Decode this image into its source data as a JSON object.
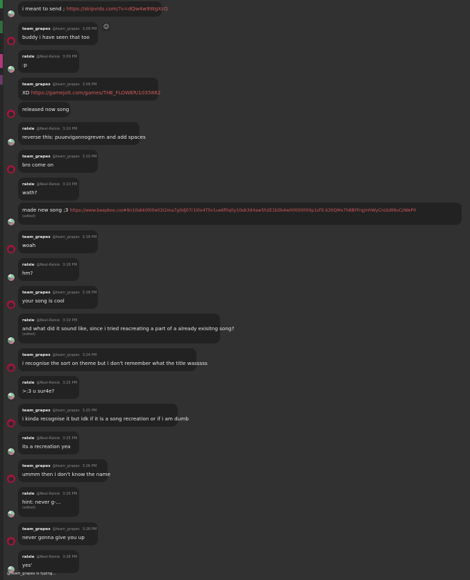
{
  "colors": {
    "background": "#313131",
    "bubble": "#222222",
    "link": "#d65a5a",
    "muted": "#8a8a8a"
  },
  "react_icon": "add-reaction-icon",
  "messages": [
    {
      "id": "m1",
      "author": "ralsie",
      "name": "",
      "handle": "",
      "time": "",
      "text": "i meant to send ; ",
      "link": "https://skipvids.com/?v=dQw4w9WgXcQ",
      "edited": ""
    },
    {
      "id": "m2",
      "author": "grapes",
      "name": "team_grapes",
      "handle": "@team_grapes",
      "time": "3:09 PM",
      "text": "buddy i have seen that too",
      "link": "",
      "edited": ""
    },
    {
      "id": "m3",
      "author": "ralsie",
      "name": "ralsie",
      "handle": "@Real-Ralsie",
      "time": "3:09 PM",
      "text": ":p",
      "link": "",
      "edited": ""
    },
    {
      "id": "m4",
      "author": "grapes",
      "name": "team_grapes",
      "handle": "@team_grapes",
      "time": "3:09 PM",
      "text": "XD ",
      "link": "https://gamejolt.com/games/THE_FLOWER/1035882",
      "edited": ""
    },
    {
      "id": "m5",
      "author": "grapes",
      "name": "",
      "handle": "",
      "time": "",
      "text": "released now song",
      "link": "",
      "edited": ""
    },
    {
      "id": "m6",
      "author": "ralsie",
      "name": "ralsie",
      "handle": "@Real-Ralsie",
      "time": "3:10 PM",
      "text": "reverse this: puuevigannogreven and add spaces",
      "link": "",
      "edited": ""
    },
    {
      "id": "m7",
      "author": "grapes",
      "name": "team_grapes",
      "handle": "@team_grapes",
      "time": "3:10 PM",
      "text": "bro come on",
      "link": "",
      "edited": ""
    },
    {
      "id": "m8",
      "author": "ralsie",
      "name": "ralsie",
      "handle": "@Real-Ralsie",
      "time": "3:10 PM",
      "text": "wath?",
      "link": "",
      "edited": ""
    },
    {
      "id": "m9",
      "author": "ralsie",
      "name": "",
      "handle": "",
      "time": "",
      "text": "made new song ;3 ",
      "link": "https://www.beepbox.co/#9n10sbk0l00e01t2ma7g0dj07r1i0o4T0v1ue6f0q0y10ob3d4aw5h2E1b5b4w00000000p1sFE-k30QMx7h8BYFrqjmhWyCnULW9uCzWeP0",
      "edited": "(edited)"
    },
    {
      "id": "m10",
      "author": "grapes",
      "name": "team_grapes",
      "handle": "@team_grapes",
      "time": "3:18 PM",
      "text": "woah",
      "link": "",
      "edited": ""
    },
    {
      "id": "m11",
      "author": "ralsie",
      "name": "ralsie",
      "handle": "@Real-Ralsie",
      "time": "3:18 PM",
      "text": "hm?",
      "link": "",
      "edited": ""
    },
    {
      "id": "m12",
      "author": "grapes",
      "name": "team_grapes",
      "handle": "@team_grapes",
      "time": "3:18 PM",
      "text": "your song is cool",
      "link": "",
      "edited": ""
    },
    {
      "id": "m13",
      "author": "ralsie",
      "name": "ralsie",
      "handle": "@Real-Ralsie",
      "time": "3:19 PM",
      "text": "and what did it sound like, since i tried reacreating a part of a already exisitng song?",
      "link": "",
      "edited": "(edited)"
    },
    {
      "id": "m14",
      "author": "grapes",
      "name": "team_grapes",
      "handle": "@team_grapes",
      "time": "3:24 PM",
      "text": "i recognise the sort on theme but i don't remember what the title wasssss",
      "link": "",
      "edited": ""
    },
    {
      "id": "m15",
      "author": "ralsie",
      "name": "ralsie",
      "handle": "@Real-Ralsie",
      "time": "3:25 PM",
      "text": ">:3 u sur4e?",
      "link": "",
      "edited": ""
    },
    {
      "id": "m16",
      "author": "grapes",
      "name": "team_grapes",
      "handle": "@team_grapes",
      "time": "3:25 PM",
      "text": "i kinda recognise it but idk if it is a song recreation or if i am dumb",
      "link": "",
      "edited": ""
    },
    {
      "id": "m17",
      "author": "ralsie",
      "name": "ralsie",
      "handle": "@Real-Ralsie",
      "time": "3:25 PM",
      "text": "its a recreation yea",
      "link": "",
      "edited": ""
    },
    {
      "id": "m18",
      "author": "grapes",
      "name": "team_grapes",
      "handle": "@team_grapes",
      "time": "3:26 PM",
      "text": "ummm then i don't know the name",
      "link": "",
      "edited": ""
    },
    {
      "id": "m19",
      "author": "ralsie",
      "name": "ralsie",
      "handle": "@Real-Ralsie",
      "time": "3:26 PM",
      "text": "hint: never g-...",
      "link": "",
      "edited": "(edited)"
    },
    {
      "id": "m20",
      "author": "grapes",
      "name": "team_grapes",
      "handle": "@team_grapes",
      "time": "3:28 PM",
      "text": "never gonna give you up",
      "link": "",
      "edited": ""
    },
    {
      "id": "m21",
      "author": "ralsie",
      "name": "ralsie",
      "handle": "@Real-Ralsie",
      "time": "3:28 PM",
      "text": "yes'",
      "link": "",
      "edited": ""
    }
  ],
  "typing_indicator": "@team_grapes is typing..."
}
